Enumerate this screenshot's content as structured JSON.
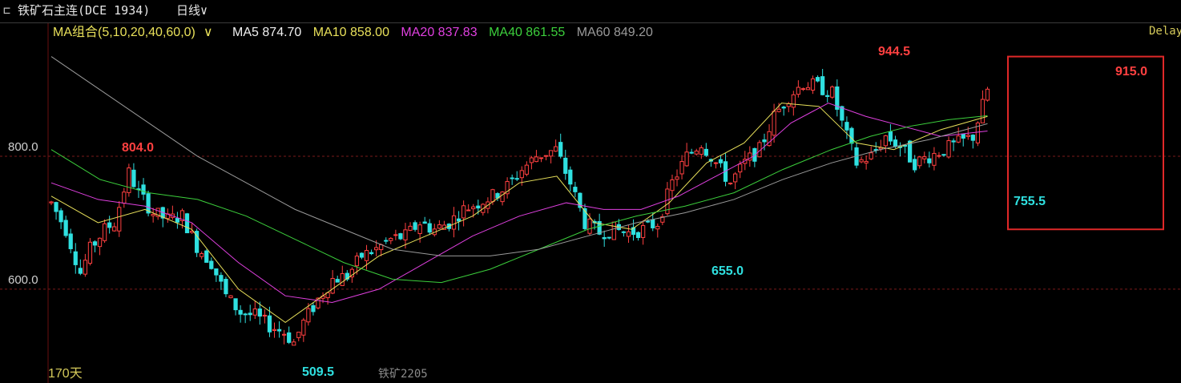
{
  "window": {
    "symbol": "铁矿石主连(DCE 1934)",
    "period": "日线",
    "delay_label": "Delay"
  },
  "legend": {
    "title": "MA组合(5,10,20,40,60,0)",
    "items": [
      {
        "label": "MA5 874.70",
        "color": "#f0f0f0"
      },
      {
        "label": "MA10 858.00",
        "color": "#e8e05a"
      },
      {
        "label": "MA20 837.83",
        "color": "#e040e0"
      },
      {
        "label": "MA40 861.55",
        "color": "#3ccf3c"
      },
      {
        "label": "MA60 849.20",
        "color": "#9a9a9a"
      }
    ]
  },
  "footer": {
    "days_label": "170天",
    "contract_label": "铁矿2205"
  },
  "colors": {
    "up": "#ff4040",
    "down": "#2fe0e0",
    "grid": "#7a1a1a",
    "highlight_box": "#e02828"
  },
  "chart_data": {
    "type": "candlestick",
    "y_ticks": [
      {
        "value": 600,
        "label": "600.0"
      },
      {
        "value": 800,
        "label": "800.0"
      }
    ],
    "ylim": [
      495,
      970
    ],
    "num_bars": 170,
    "annotations": [
      {
        "label": "804.0",
        "value": 804.0,
        "bar": 16,
        "type": "high"
      },
      {
        "label": "509.5",
        "value": 509.5,
        "bar": 50,
        "type": "low"
      },
      {
        "label": "655.0",
        "value": 655.0,
        "bar": 126,
        "type": "low"
      },
      {
        "label": "944.5",
        "value": 944.5,
        "bar": 153,
        "type": "high"
      },
      {
        "label": "755.5",
        "value": 755.5,
        "bar": 163,
        "type": "low"
      },
      {
        "label": "915.0",
        "value": 915.0,
        "bar": 168,
        "type": "high"
      }
    ],
    "highlight": {
      "from_bar": 151,
      "to_bar": 170,
      "low": 690,
      "high": 950
    },
    "price_path": [
      [
        0,
        730
      ],
      [
        3,
        690
      ],
      [
        6,
        625
      ],
      [
        8,
        660
      ],
      [
        11,
        690
      ],
      [
        13,
        700
      ],
      [
        16,
        775
      ],
      [
        18,
        745
      ],
      [
        21,
        715
      ],
      [
        24,
        705
      ],
      [
        27,
        710
      ],
      [
        30,
        665
      ],
      [
        33,
        640
      ],
      [
        36,
        590
      ],
      [
        39,
        565
      ],
      [
        42,
        560
      ],
      [
        45,
        545
      ],
      [
        48,
        535
      ],
      [
        50,
        520
      ],
      [
        52,
        550
      ],
      [
        55,
        585
      ],
      [
        58,
        615
      ],
      [
        61,
        620
      ],
      [
        64,
        650
      ],
      [
        67,
        660
      ],
      [
        70,
        675
      ],
      [
        73,
        680
      ],
      [
        76,
        700
      ],
      [
        79,
        690
      ],
      [
        82,
        700
      ],
      [
        85,
        720
      ],
      [
        88,
        730
      ],
      [
        91,
        740
      ],
      [
        94,
        755
      ],
      [
        97,
        780
      ],
      [
        100,
        800
      ],
      [
        102,
        805
      ],
      [
        104,
        810
      ],
      [
        107,
        760
      ],
      [
        110,
        700
      ],
      [
        113,
        685
      ],
      [
        116,
        690
      ],
      [
        119,
        685
      ],
      [
        122,
        690
      ],
      [
        125,
        700
      ],
      [
        128,
        760
      ],
      [
        131,
        800
      ],
      [
        134,
        820
      ],
      [
        137,
        790
      ],
      [
        140,
        760
      ],
      [
        143,
        790
      ],
      [
        146,
        810
      ],
      [
        149,
        860
      ],
      [
        152,
        890
      ],
      [
        155,
        910
      ],
      [
        158,
        905
      ],
      [
        161,
        895
      ],
      [
        163,
        850
      ],
      [
        166,
        790
      ],
      [
        169,
        800
      ],
      [
        172,
        830
      ],
      [
        175,
        815
      ],
      [
        178,
        790
      ],
      [
        181,
        800
      ],
      [
        184,
        810
      ],
      [
        187,
        820
      ],
      [
        190,
        830
      ],
      [
        193,
        900
      ]
    ],
    "ma_series": [
      {
        "name": "MA10",
        "color": "#e8e05a",
        "points": [
          [
            0,
            740
          ],
          [
            10,
            700
          ],
          [
            20,
            720
          ],
          [
            30,
            690
          ],
          [
            40,
            600
          ],
          [
            50,
            550
          ],
          [
            60,
            600
          ],
          [
            70,
            650
          ],
          [
            80,
            680
          ],
          [
            90,
            710
          ],
          [
            100,
            760
          ],
          [
            108,
            770
          ],
          [
            116,
            700
          ],
          [
            124,
            690
          ],
          [
            132,
            730
          ],
          [
            140,
            790
          ],
          [
            148,
            820
          ],
          [
            156,
            880
          ],
          [
            164,
            875
          ],
          [
            172,
            820
          ],
          [
            180,
            810
          ],
          [
            190,
            840
          ],
          [
            200,
            860
          ]
        ]
      },
      {
        "name": "MA20",
        "color": "#e040e0",
        "points": [
          [
            0,
            760
          ],
          [
            10,
            735
          ],
          [
            20,
            725
          ],
          [
            30,
            700
          ],
          [
            40,
            640
          ],
          [
            50,
            590
          ],
          [
            60,
            580
          ],
          [
            70,
            600
          ],
          [
            80,
            640
          ],
          [
            90,
            680
          ],
          [
            100,
            710
          ],
          [
            110,
            730
          ],
          [
            118,
            720
          ],
          [
            126,
            720
          ],
          [
            134,
            740
          ],
          [
            142,
            770
          ],
          [
            150,
            800
          ],
          [
            158,
            850
          ],
          [
            166,
            880
          ],
          [
            174,
            860
          ],
          [
            182,
            845
          ],
          [
            190,
            830
          ],
          [
            200,
            838
          ]
        ]
      },
      {
        "name": "MA40",
        "color": "#3ccf3c",
        "points": [
          [
            0,
            810
          ],
          [
            10,
            765
          ],
          [
            20,
            745
          ],
          [
            30,
            735
          ],
          [
            40,
            710
          ],
          [
            50,
            675
          ],
          [
            60,
            640
          ],
          [
            70,
            615
          ],
          [
            80,
            610
          ],
          [
            90,
            630
          ],
          [
            100,
            660
          ],
          [
            110,
            690
          ],
          [
            120,
            710
          ],
          [
            130,
            725
          ],
          [
            140,
            745
          ],
          [
            150,
            780
          ],
          [
            160,
            810
          ],
          [
            168,
            830
          ],
          [
            176,
            845
          ],
          [
            184,
            855
          ],
          [
            192,
            861
          ]
        ]
      },
      {
        "name": "MA60",
        "color": "#9a9a9a",
        "points": [
          [
            0,
            950
          ],
          [
            10,
            900
          ],
          [
            20,
            850
          ],
          [
            30,
            800
          ],
          [
            40,
            760
          ],
          [
            50,
            720
          ],
          [
            60,
            690
          ],
          [
            70,
            660
          ],
          [
            80,
            650
          ],
          [
            90,
            650
          ],
          [
            100,
            660
          ],
          [
            110,
            680
          ],
          [
            120,
            700
          ],
          [
            130,
            715
          ],
          [
            140,
            735
          ],
          [
            150,
            765
          ],
          [
            160,
            790
          ],
          [
            170,
            810
          ],
          [
            180,
            825
          ],
          [
            192,
            849
          ]
        ]
      }
    ]
  }
}
